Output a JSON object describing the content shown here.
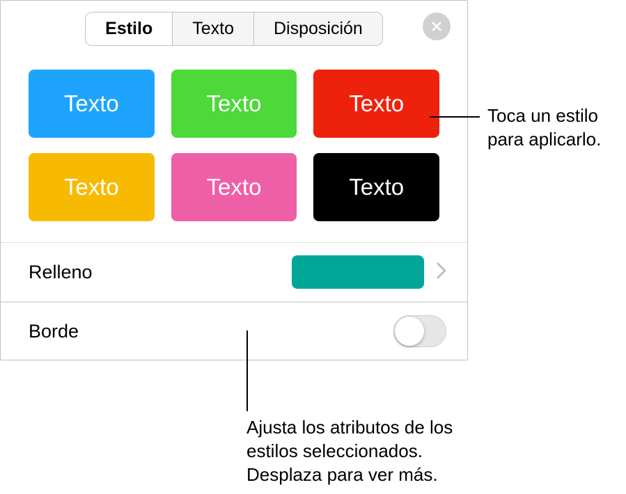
{
  "tabs": {
    "style": "Estilo",
    "text": "Texto",
    "layout": "Disposición"
  },
  "swatches": [
    {
      "label": "Texto",
      "bg": "#1ea4fc",
      "fg": "#ffffff"
    },
    {
      "label": "Texto",
      "bg": "#4cd939",
      "fg": "#ffffff"
    },
    {
      "label": "Texto",
      "bg": "#ee220c",
      "fg": "#ffffff"
    },
    {
      "label": "Texto",
      "bg": "#f8ba00",
      "fg": "#ffffff"
    },
    {
      "label": "Texto",
      "bg": "#ef5fa7",
      "fg": "#ffffff"
    },
    {
      "label": "Texto",
      "bg": "#000000",
      "fg": "#ffffff"
    }
  ],
  "fill": {
    "label": "Relleno",
    "color": "#00a698"
  },
  "border": {
    "label": "Borde",
    "enabled": false
  },
  "callouts": {
    "top": "Toca un estilo para aplicarlo.",
    "bottom": "Ajusta los atributos de los estilos seleccionados. Desplaza para ver más."
  }
}
